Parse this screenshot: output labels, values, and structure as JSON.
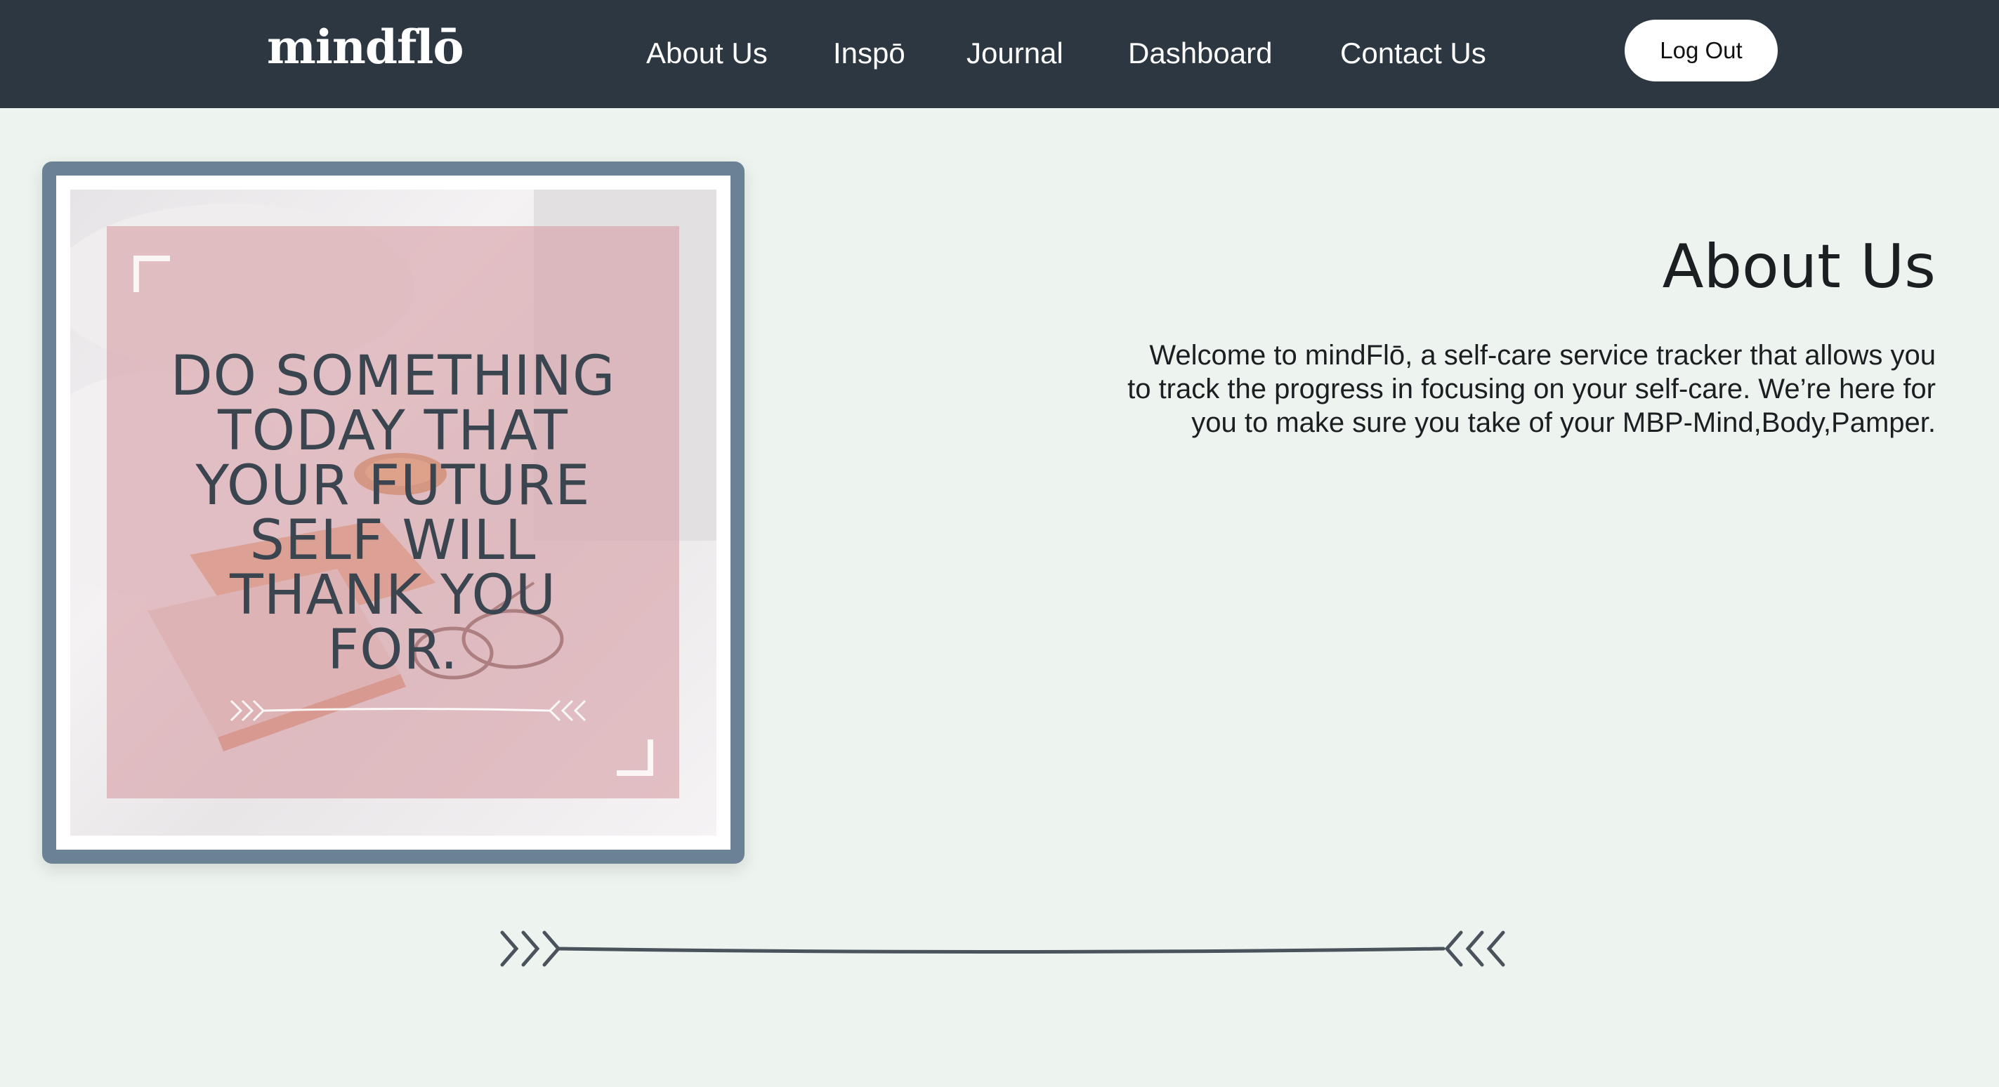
{
  "header": {
    "logo": "mindflō",
    "nav": [
      {
        "label": "About Us"
      },
      {
        "label": "Inspō"
      },
      {
        "label": "Journal"
      },
      {
        "label": "Dashboard"
      },
      {
        "label": "Contact Us"
      }
    ],
    "logout_label": "Log Out"
  },
  "hero_image": {
    "quote_lines": [
      "DO SOMETHING",
      "TODAY THAT",
      "YOUR FUTURE",
      "SELF WILL",
      "THANK YOU",
      "FOR."
    ]
  },
  "about": {
    "title": "About Us",
    "text_lines": [
      "Welcome to mindFlō, a self-care service tracker that allows you",
      "to track the progress in focusing on your self-care. We’re here for",
      "you to make sure you take of your MBP-Mind,Body,Pamper."
    ]
  },
  "colors": {
    "navbar": "#2d3741",
    "page_background": "#edf3ef",
    "frame_border": "#6b8196",
    "quote_overlay": "#d6a0a6",
    "text": "#1c1f22"
  }
}
